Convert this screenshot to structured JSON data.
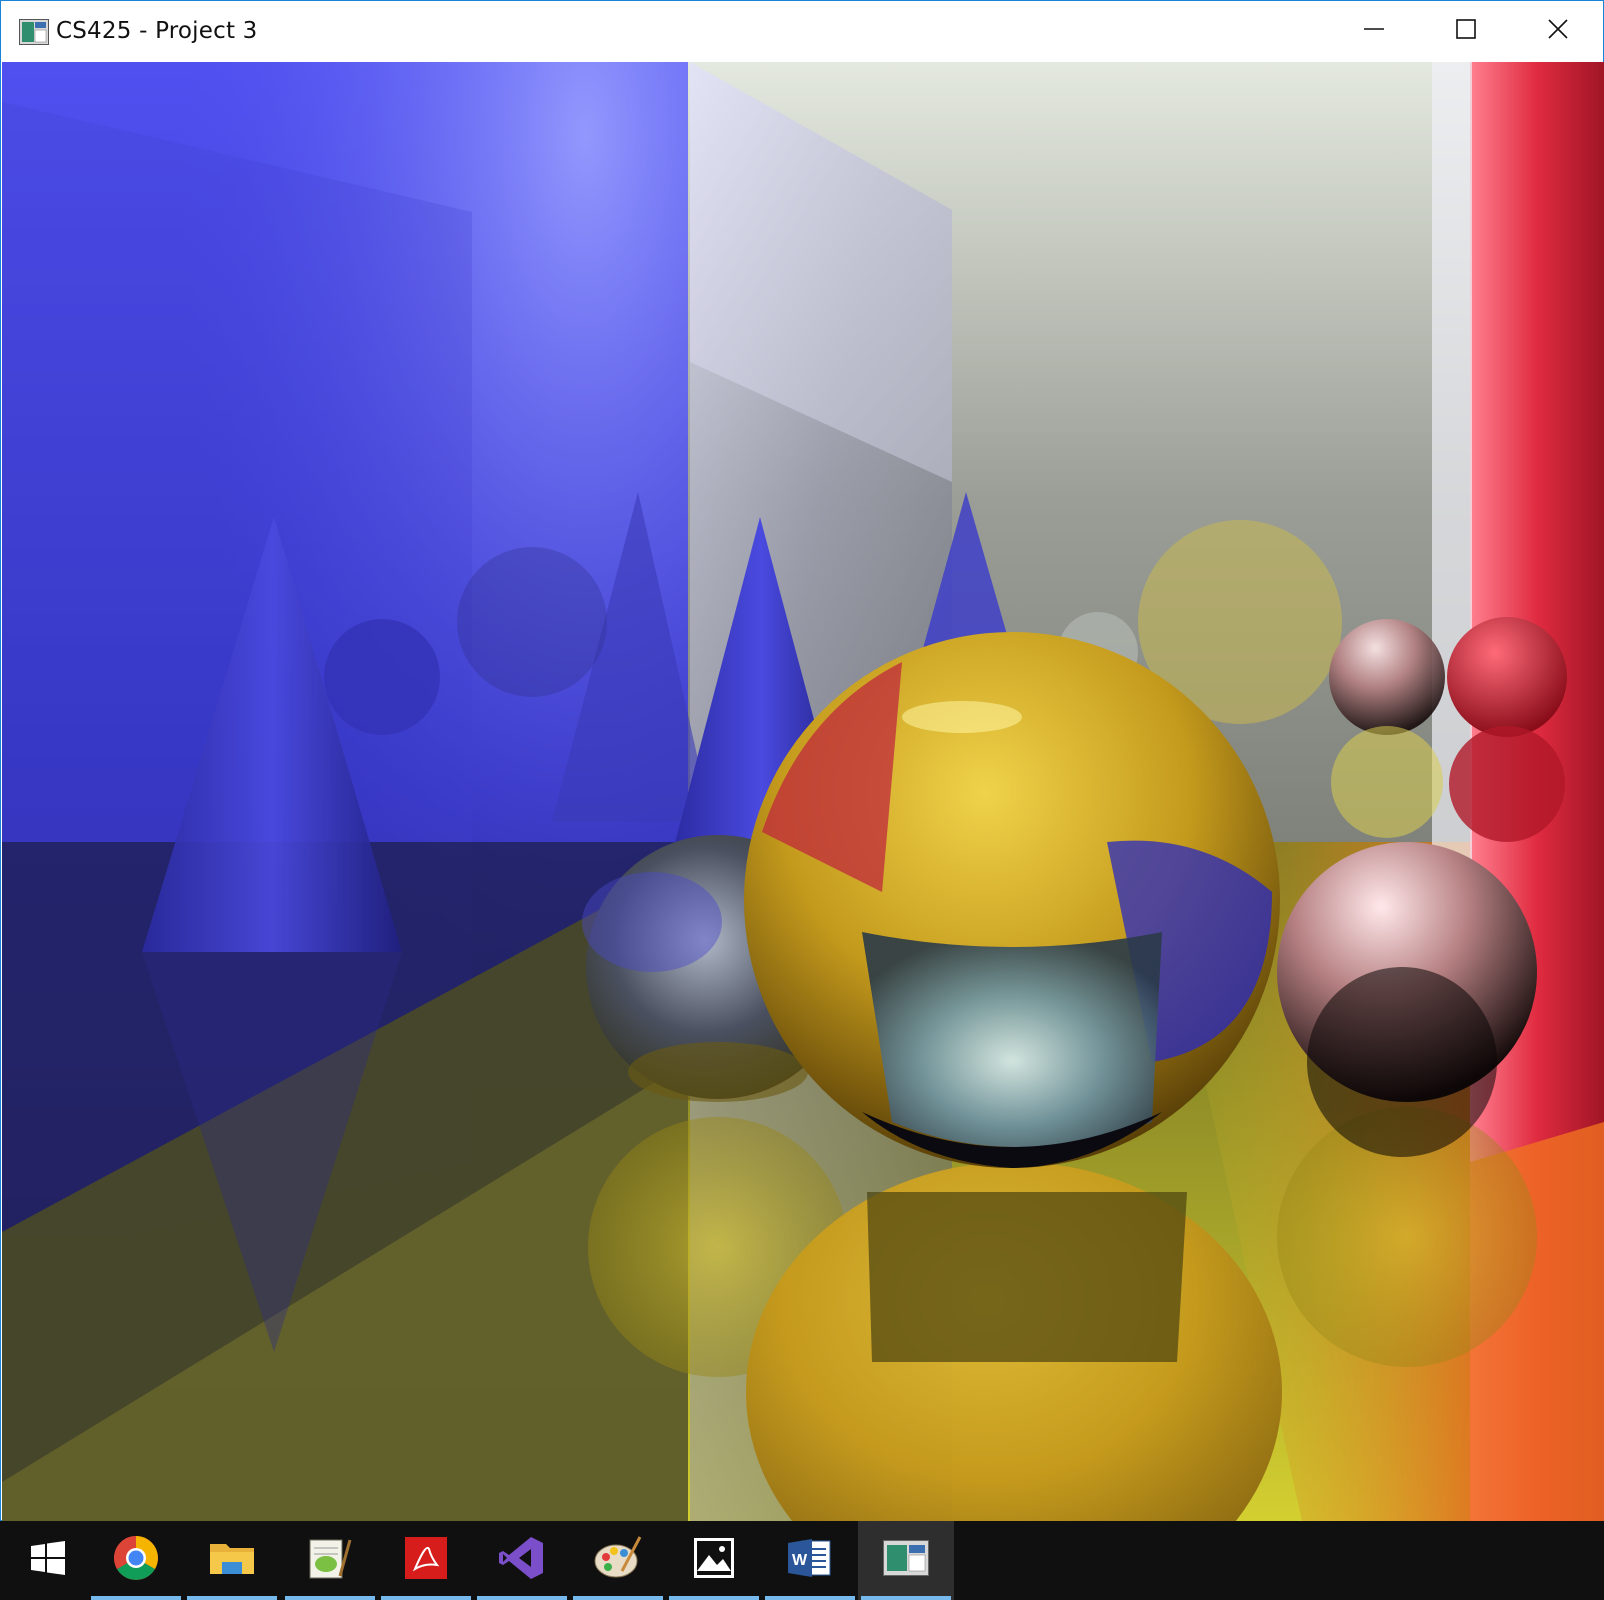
{
  "window": {
    "title": "CS425 - Project 3",
    "controls": {
      "minimize": "minimize-icon",
      "maximize": "maximize-icon",
      "close": "close-icon"
    }
  },
  "render": {
    "description_icon": "raytraced-scene",
    "palette": {
      "left_wall": "#3b3bd9",
      "back_wall": "#8a8e86",
      "right_wall": "#d0253a",
      "floor": "#b5b124",
      "cone": "#3434b8",
      "sphere_gold": "#d8b927",
      "sphere_glass": "#6fa3b4",
      "sphere_pink": "#c98d8f"
    }
  },
  "taskbar": {
    "items": [
      {
        "name": "start-button",
        "icon": "windows-logo-icon",
        "running": false
      },
      {
        "name": "chrome-taskbar-button",
        "icon": "chrome-icon",
        "running": true
      },
      {
        "name": "file-explorer-taskbar-button",
        "icon": "folder-icon",
        "running": true
      },
      {
        "name": "notepadpp-taskbar-button",
        "icon": "notepad-plus-plus-icon",
        "running": true
      },
      {
        "name": "acrobat-taskbar-button",
        "icon": "acrobat-icon",
        "running": true
      },
      {
        "name": "visual-studio-taskbar-button",
        "icon": "visual-studio-icon",
        "running": true
      },
      {
        "name": "paint-taskbar-button",
        "icon": "paint-palette-icon",
        "running": true
      },
      {
        "name": "photos-taskbar-button",
        "icon": "photos-icon",
        "running": true
      },
      {
        "name": "word-taskbar-button",
        "icon": "word-icon",
        "running": true
      },
      {
        "name": "project3-taskbar-button",
        "icon": "app-window-icon",
        "running": true,
        "active": true
      }
    ]
  }
}
